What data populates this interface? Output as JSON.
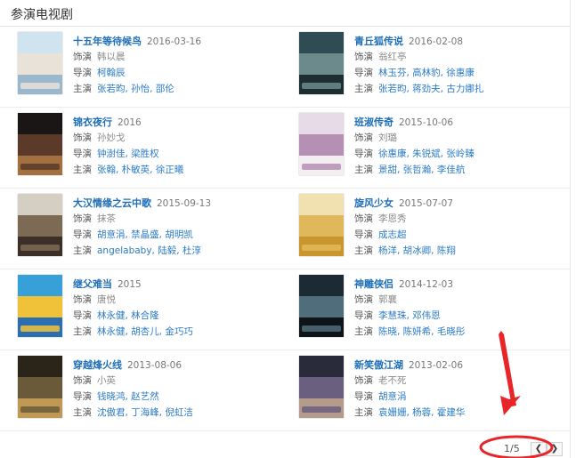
{
  "section_title": "参演电视剧",
  "labels": {
    "role": "饰演",
    "director": "导演",
    "cast": "主演"
  },
  "shows": [
    {
      "title": "十五年等待候鸟",
      "date": "2016-03-16",
      "role": "韩以晨",
      "director": "柯翰辰",
      "cast": "张若昀, 孙怡, 邵伦",
      "poster_colors": [
        "#cfe4ef",
        "#e9e2d8",
        "#9ab7cc"
      ]
    },
    {
      "title": "青丘狐传说",
      "date": "2016-02-08",
      "role": "翁红亭",
      "director": "林玉芬, 高林豹, 徐惠康",
      "cast": "张若昀, 蒋劲夫, 古力娜扎",
      "poster_colors": [
        "#2f4c55",
        "#6c8a8c",
        "#1d2e33"
      ]
    },
    {
      "title": "锦衣夜行",
      "date": "2016",
      "role": "孙妙戈",
      "director": "钟澍佳, 梁胜权",
      "cast": "张翰, 朴敏英, 徐正曦",
      "poster_colors": [
        "#1a1616",
        "#5b3a2a",
        "#a2713f"
      ]
    },
    {
      "title": "班淑传奇",
      "date": "2015-10-06",
      "role": "刘璐",
      "director": "徐惠康, 朱锐斌, 张岭臻",
      "cast": "景甜, 张哲瀚, 李佳航",
      "poster_colors": [
        "#e8dbe8",
        "#b58fb4",
        "#f3eef2"
      ]
    },
    {
      "title": "大汉情缘之云中歌",
      "date": "2015-09-13",
      "role": "抹茶",
      "director": "胡意涓, 禁晶盛, 胡明凯",
      "cast": "angelababy, 陆毅, 杜淳",
      "poster_colors": [
        "#d5cfc3",
        "#7d6a55",
        "#3c2f27"
      ]
    },
    {
      "title": "旋风少女",
      "date": "2015-07-07",
      "role": "李恩秀",
      "director": "成志超",
      "cast": "杨洋, 胡冰卿, 陈翔",
      "poster_colors": [
        "#f1e1b0",
        "#e0b85c",
        "#c9952d"
      ]
    },
    {
      "title": "继父难当",
      "date": "2015",
      "role": "唐悦",
      "director": "林永健, 林合隆",
      "cast": "林永健, 胡杏儿, 金巧巧",
      "poster_colors": [
        "#38a0d8",
        "#f0c23a",
        "#2c6fb0"
      ]
    },
    {
      "title": "神雕侠侣",
      "date": "2014-12-03",
      "role": "郭襄",
      "director": "李慧珠, 邓伟恩",
      "cast": "陈晓, 陈妍希, 毛晓彤",
      "poster_colors": [
        "#1c2a33",
        "#4f6d7a",
        "#0e1418"
      ]
    },
    {
      "title": "穿越烽火线",
      "date": "2013-08-06",
      "role": "小英",
      "director": "钱晓鸿, 赵艺然",
      "cast": "沈傲君, 丁海峰, 倪虹洁",
      "poster_colors": [
        "#2b2418",
        "#6b5a3a",
        "#c09a55"
      ]
    },
    {
      "title": "新笑傲江湖",
      "date": "2013-02-06",
      "role": "老不死",
      "director": "胡意涓",
      "cast": "袁姗姗, 杨蓉, 霍建华",
      "poster_colors": [
        "#2a2b3a",
        "#6a5f7e",
        "#b59b8c"
      ]
    }
  ],
  "pagination": {
    "current_page": 1,
    "total_pages": 5,
    "text": "1/5",
    "prev_icon": "chevron-left-icon",
    "next_icon": "chevron-right-icon"
  },
  "annotation": {
    "color": "#e8262a"
  }
}
